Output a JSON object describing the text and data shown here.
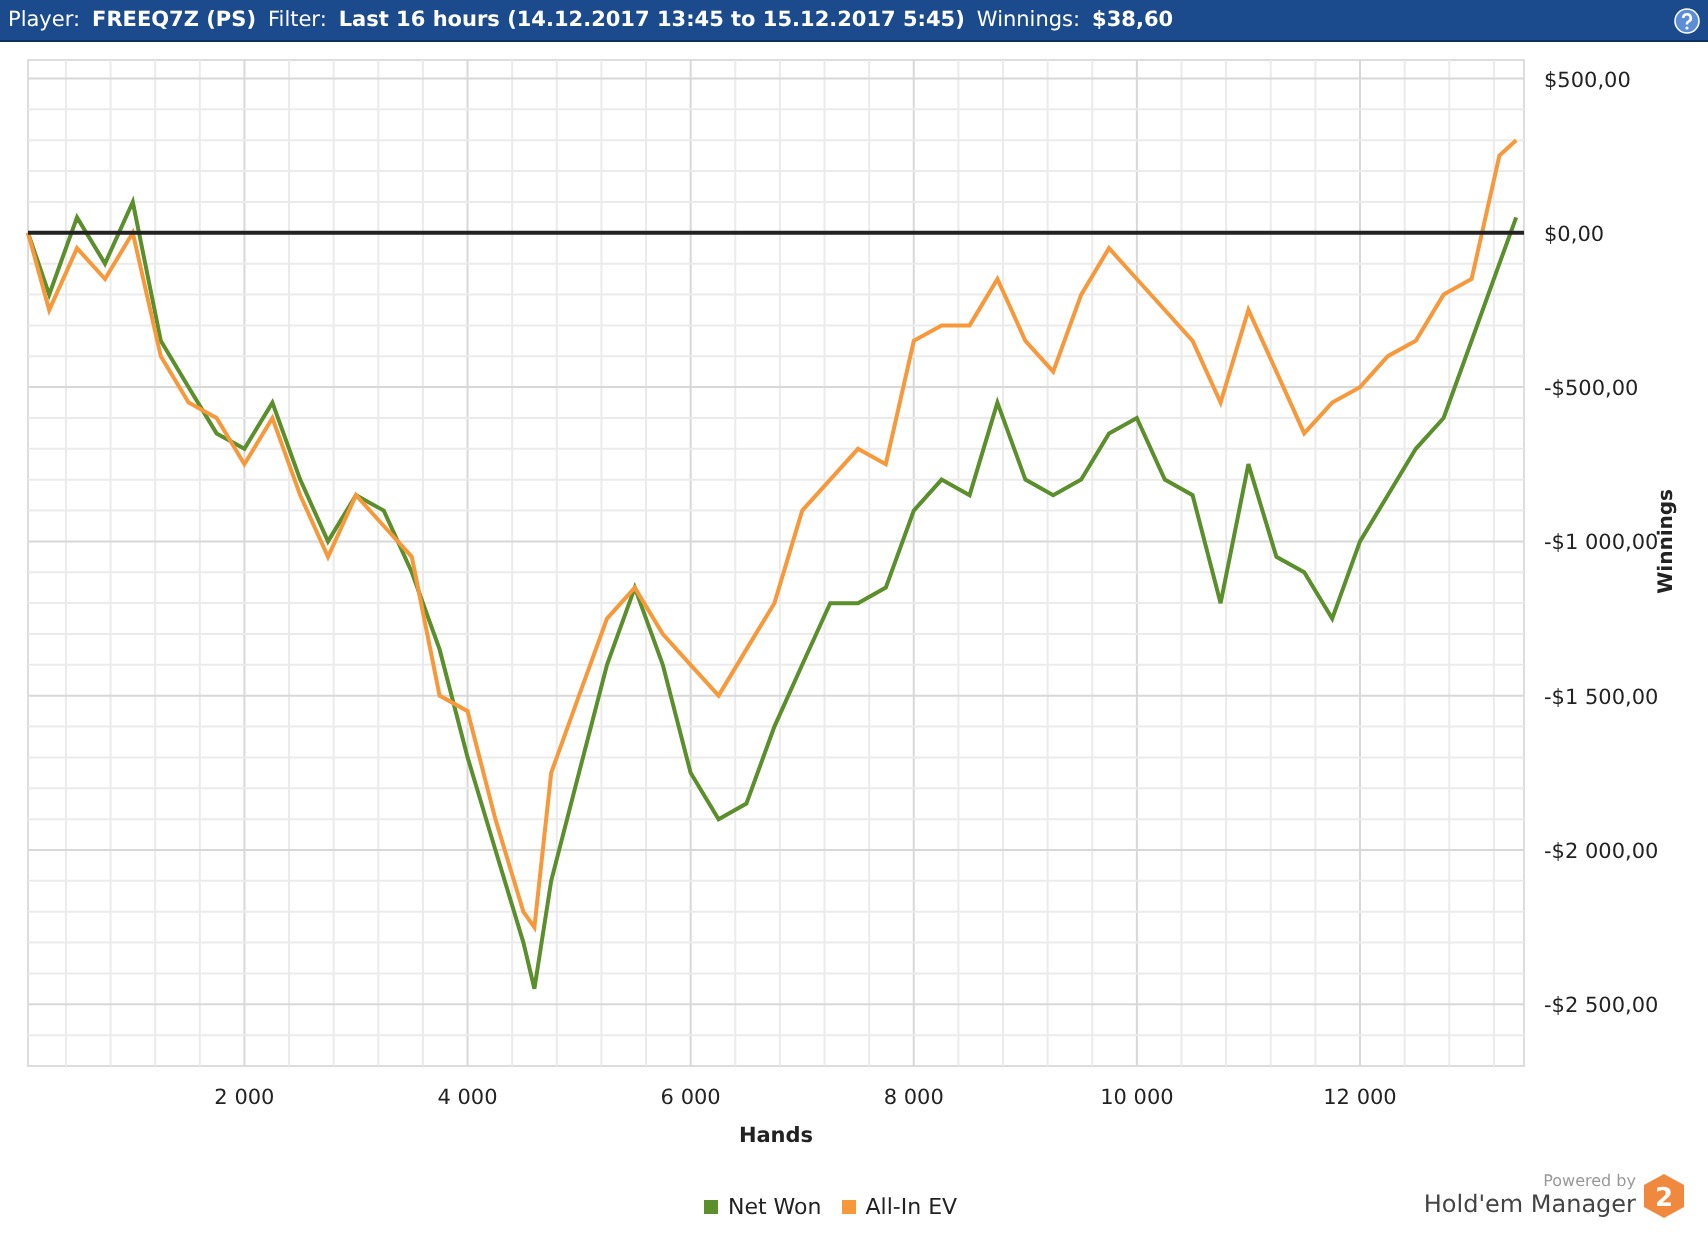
{
  "header": {
    "fields": [
      {
        "label": "Player:",
        "value": "FREEQ7Z (PS)"
      },
      {
        "label": "Filter:",
        "value": "Last 16 hours (14.12.2017 13:45 to 15.12.2017 5:45)"
      },
      {
        "label": "Winnings:",
        "value": "$38,60"
      }
    ]
  },
  "chart": {
    "chart_data": {
      "type": "line",
      "grid": true,
      "xlabel": "Hands",
      "ylabel": "Winnings",
      "xlim": [
        60,
        13470
      ],
      "ylim": [
        -2700,
        560
      ],
      "xticks": [
        {
          "value": 2000,
          "label": "2 000"
        },
        {
          "value": 4000,
          "label": "4 000"
        },
        {
          "value": 6000,
          "label": "6 000"
        },
        {
          "value": 8000,
          "label": "8 000"
        },
        {
          "value": 10000,
          "label": "10 000"
        },
        {
          "value": 12000,
          "label": "12 000"
        }
      ],
      "yticks": [
        {
          "value": 500,
          "label": "$500,00"
        },
        {
          "value": 0,
          "label": "$0,00"
        },
        {
          "value": -500,
          "label": "-$500,00"
        },
        {
          "value": -1000,
          "label": "-$1 000,00"
        },
        {
          "value": -1500,
          "label": "-$1 500,00"
        },
        {
          "value": -2000,
          "label": "-$2 000,00"
        },
        {
          "value": -2500,
          "label": "-$2 500,00"
        }
      ],
      "x": [
        60,
        250,
        500,
        750,
        1000,
        1250,
        1500,
        1750,
        2000,
        2250,
        2500,
        2750,
        3000,
        3250,
        3500,
        3750,
        4000,
        4250,
        4500,
        4600,
        4750,
        5000,
        5250,
        5500,
        5750,
        6000,
        6250,
        6500,
        6750,
        7000,
        7250,
        7500,
        7750,
        8000,
        8250,
        8500,
        8750,
        9000,
        9250,
        9500,
        9750,
        10000,
        10250,
        10500,
        10750,
        11000,
        11250,
        11500,
        11750,
        12000,
        12250,
        12500,
        12750,
        13000,
        13250,
        13400
      ],
      "series": [
        {
          "name": "Net Won",
          "color": "#5b8f2c",
          "values": [
            0,
            -200,
            50,
            -100,
            100,
            -350,
            -500,
            -650,
            -700,
            -550,
            -800,
            -1000,
            -850,
            -900,
            -1100,
            -1350,
            -1700,
            -2000,
            -2300,
            -2450,
            -2100,
            -1750,
            -1400,
            -1150,
            -1400,
            -1750,
            -1900,
            -1850,
            -1600,
            -1400,
            -1200,
            -1200,
            -1150,
            -900,
            -800,
            -850,
            -550,
            -800,
            -850,
            -800,
            -650,
            -600,
            -800,
            -850,
            -1200,
            -750,
            -1050,
            -1100,
            -1250,
            -1000,
            -850,
            -700,
            -600,
            -350,
            -100,
            50
          ]
        },
        {
          "name": "All-In EV",
          "color": "#f7993a",
          "values": [
            0,
            -250,
            -50,
            -150,
            0,
            -400,
            -550,
            -600,
            -750,
            -600,
            -850,
            -1050,
            -850,
            -950,
            -1050,
            -1500,
            -1550,
            -1900,
            -2200,
            -2250,
            -1750,
            -1500,
            -1250,
            -1150,
            -1300,
            -1400,
            -1500,
            -1350,
            -1200,
            -900,
            -800,
            -700,
            -750,
            -350,
            -300,
            -300,
            -150,
            -350,
            -450,
            -200,
            -50,
            -150,
            -250,
            -350,
            -550,
            -250,
            -450,
            -650,
            -550,
            -500,
            -400,
            -350,
            -200,
            -150,
            250,
            300
          ]
        }
      ]
    }
  },
  "branding": {
    "tagline": "Powered by",
    "name": "Hold'em Manager",
    "logo_mark": "2"
  }
}
